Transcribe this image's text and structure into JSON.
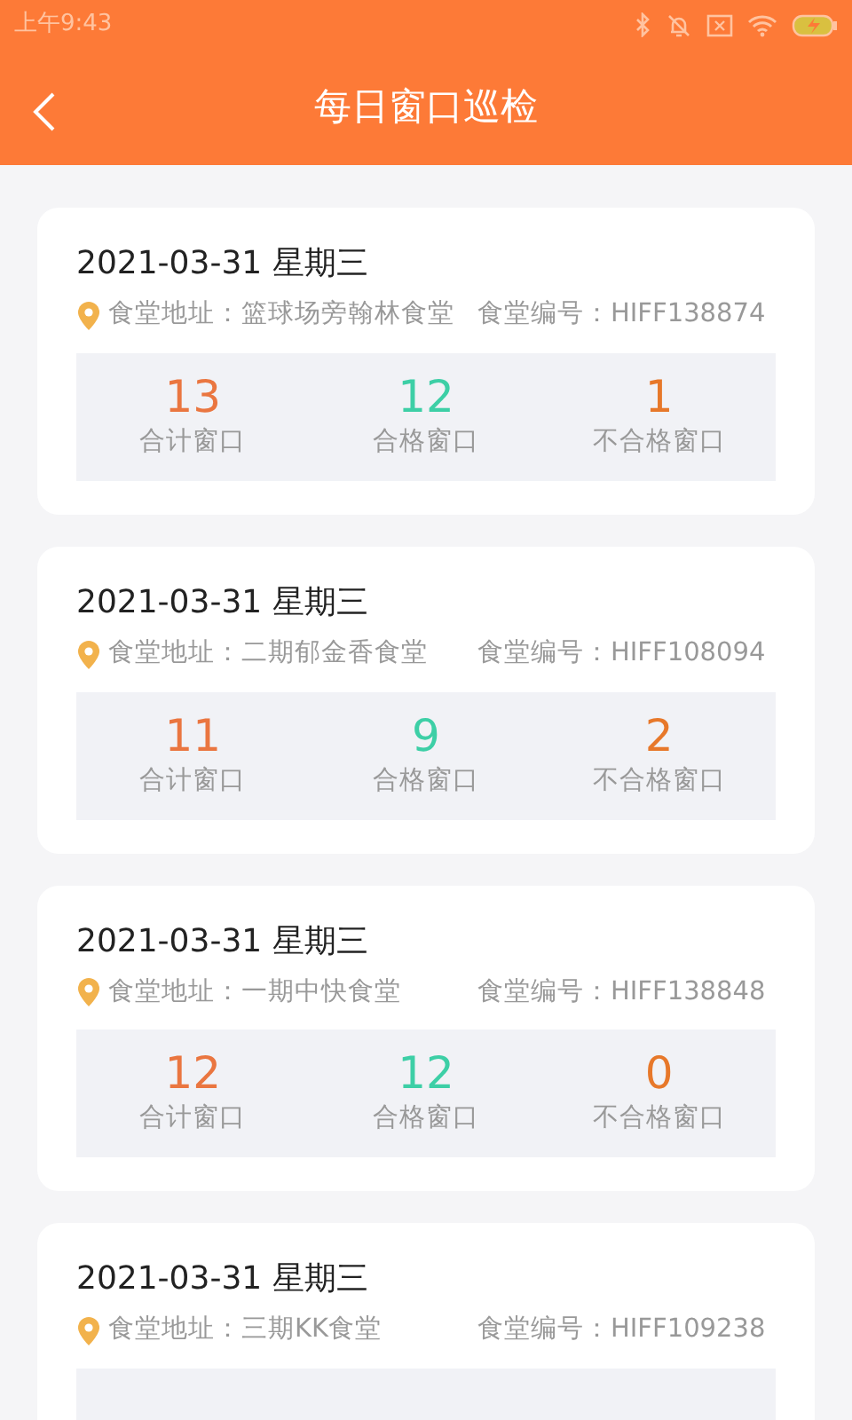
{
  "status_bar": {
    "time": "上午9:43"
  },
  "header": {
    "title": "每日窗口巡检"
  },
  "records": [
    {
      "date": "2021-03-31 星期三",
      "address": "食堂地址：篮球场旁翰林食堂",
      "code": "食堂编号：HIFF138874",
      "stats": [
        {
          "kind": "total",
          "value": "13",
          "label": "合计窗口"
        },
        {
          "kind": "pass",
          "value": "12",
          "label": "合格窗口"
        },
        {
          "kind": "fail",
          "value": "1",
          "label": "不合格窗口"
        }
      ]
    },
    {
      "date": "2021-03-31 星期三",
      "address": "食堂地址：二期郁金香食堂",
      "code": "食堂编号：HIFF108094",
      "stats": [
        {
          "kind": "total",
          "value": "11",
          "label": "合计窗口"
        },
        {
          "kind": "pass",
          "value": "9",
          "label": "合格窗口"
        },
        {
          "kind": "fail",
          "value": "2",
          "label": "不合格窗口"
        }
      ]
    },
    {
      "date": "2021-03-31 星期三",
      "address": "食堂地址：一期中快食堂",
      "code": "食堂编号：HIFF138848",
      "stats": [
        {
          "kind": "total",
          "value": "12",
          "label": "合计窗口"
        },
        {
          "kind": "pass",
          "value": "12",
          "label": "合格窗口"
        },
        {
          "kind": "fail",
          "value": "0",
          "label": "不合格窗口"
        }
      ]
    },
    {
      "date": "2021-03-31 星期三",
      "address": "食堂地址：三期KK食堂",
      "code": "食堂编号：HIFF109238"
    }
  ]
}
